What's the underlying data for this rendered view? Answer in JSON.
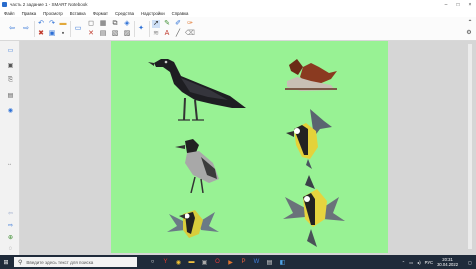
{
  "window": {
    "title": "часть 2 задание 1 - SMART Notebook",
    "minimize": "–",
    "maximize": "□",
    "close": "×"
  },
  "menu": [
    "Файл",
    "Правка",
    "Просмотр",
    "Вставка",
    "Формат",
    "Средства",
    "Надстройки",
    "Справка"
  ],
  "toolbar": {
    "icons": [
      "back-arrow-icon",
      "forward-arrow-icon",
      "undo-icon",
      "redo-icon",
      "add-page-icon",
      "delete-icon",
      "screen-shade-icon",
      "table-icon",
      "select-icon",
      "pen-icon",
      "highlighter-icon",
      "eraser-icon",
      "line-icon",
      "text-icon",
      "shape-icon",
      "fill-icon"
    ],
    "expand": "⌃"
  },
  "canvas": {
    "background": "#98f294"
  },
  "taskbar": {
    "search_placeholder": "Введите здесь текст для поиска",
    "tray_lang": "РУС",
    "time": "20:31",
    "date": "30.04.2022"
  }
}
